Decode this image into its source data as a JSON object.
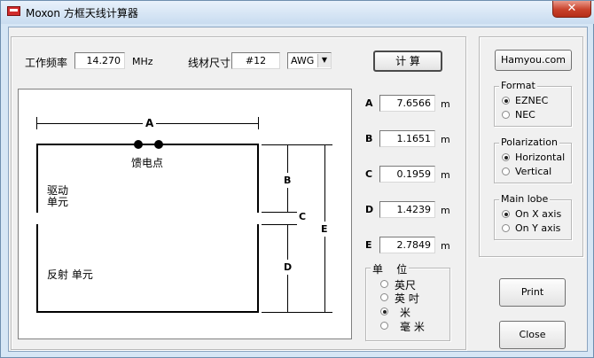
{
  "window": {
    "title": "Moxon 方框天线计算器",
    "close_glyph": "✕"
  },
  "input": {
    "freq_label": "工作频率",
    "freq_value": "14.270",
    "freq_unit": "MHz",
    "wire_label": "线材尺寸",
    "wire_value": "#12",
    "wire_type": "AWG",
    "calc_button": "计 算"
  },
  "diagram": {
    "dim_a": "A",
    "dim_b": "B",
    "dim_c": "C",
    "dim_d": "D",
    "dim_e": "E",
    "feed_label": "馈电点",
    "driven_label": "驱动\n单元",
    "reflector_label": "反射 单元"
  },
  "results": [
    {
      "name": "A",
      "value": "7.6566",
      "unit": "m"
    },
    {
      "name": "B",
      "value": "1.1651",
      "unit": "m"
    },
    {
      "name": "C",
      "value": "0.1959",
      "unit": "m"
    },
    {
      "name": "D",
      "value": "1.4239",
      "unit": "m"
    },
    {
      "name": "E",
      "value": "2.7849",
      "unit": "m"
    }
  ],
  "units": {
    "title": "单    位",
    "options": [
      {
        "label": "英尺",
        "selected": false
      },
      {
        "label": "英 吋",
        "selected": false
      },
      {
        "label": "米",
        "selected": true
      },
      {
        "label": "毫 米",
        "selected": false
      }
    ]
  },
  "right": {
    "site_button": "Hamyou.com",
    "format": {
      "title": "Format",
      "options": [
        {
          "label": "EZNEC",
          "selected": true
        },
        {
          "label": "NEC",
          "selected": false
        }
      ]
    },
    "polarization": {
      "title": "Polarization",
      "options": [
        {
          "label": "Horizontal",
          "selected": true
        },
        {
          "label": "Vertical",
          "selected": false
        }
      ]
    },
    "main_lobe": {
      "title": "Main lobe",
      "options": [
        {
          "label": "On X axis",
          "selected": true
        },
        {
          "label": "On Y axis",
          "selected": false
        }
      ]
    },
    "print_button": "Print",
    "close_button": "Close"
  }
}
